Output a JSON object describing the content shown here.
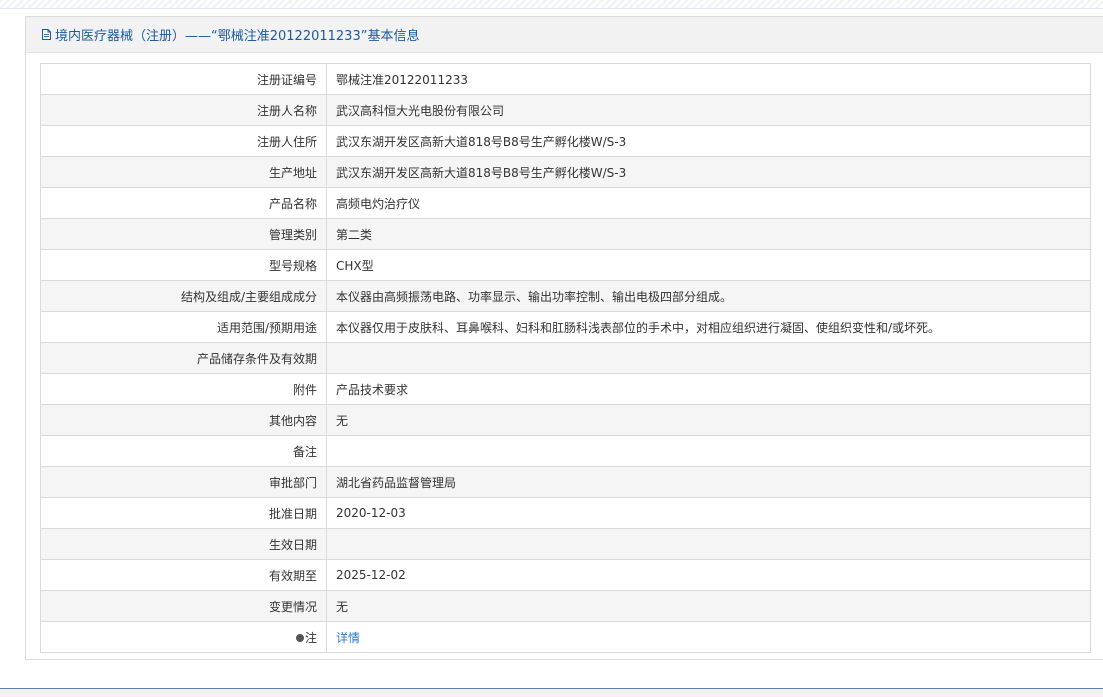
{
  "panel": {
    "title": "境内医疗器械（注册）——“鄂械注准20122011233”基本信息",
    "title_icon": "document-icon"
  },
  "rows": [
    {
      "label": "注册证编号",
      "value": "鄂械注准20122011233"
    },
    {
      "label": "注册人名称",
      "value": "武汉高科恒大光电股份有限公司"
    },
    {
      "label": "注册人住所",
      "value": "武汉东湖开发区高新大道818号B8号生产孵化楼W/S-3"
    },
    {
      "label": "生产地址",
      "value": "武汉东湖开发区高新大道818号B8号生产孵化楼W/S-3"
    },
    {
      "label": "产品名称",
      "value": "高频电灼治疗仪"
    },
    {
      "label": "管理类别",
      "value": "第二类"
    },
    {
      "label": "型号规格",
      "value": "CHX型"
    },
    {
      "label": "结构及组成/主要组成成分",
      "value": "本仪器由高频振荡电路、功率显示、输出功率控制、输出电极四部分组成。"
    },
    {
      "label": "适用范围/预期用途",
      "value": "本仪器仅用于皮肤科、耳鼻喉科、妇科和肛肠科浅表部位的手术中，对相应组织进行凝固、使组织变性和/或坏死。"
    },
    {
      "label": "产品储存条件及有效期",
      "value": ""
    },
    {
      "label": "附件",
      "value": "产品技术要求"
    },
    {
      "label": "其他内容",
      "value": "无"
    },
    {
      "label": "备注",
      "value": ""
    },
    {
      "label": "审批部门",
      "value": "湖北省药品监督管理局"
    },
    {
      "label": "批准日期",
      "value": "2020-12-03"
    },
    {
      "label": "生效日期",
      "value": ""
    },
    {
      "label": "有效期至",
      "value": "2025-12-02"
    },
    {
      "label": "变更情况",
      "value": "无"
    }
  ],
  "note_row": {
    "label": "注",
    "label_icon": "dot-icon",
    "link_text": "详情"
  }
}
